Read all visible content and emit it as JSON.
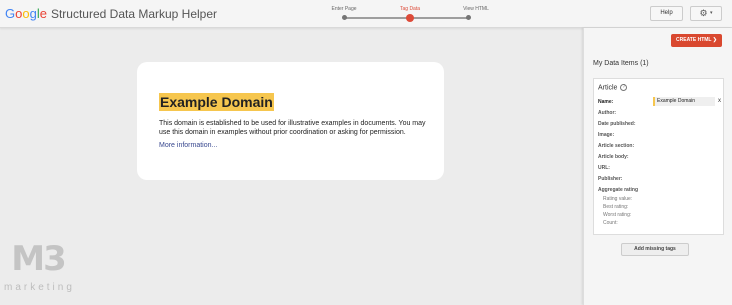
{
  "header": {
    "logo_text": "Google",
    "logo_letters": [
      {
        "char": "G",
        "color": "#4285f4"
      },
      {
        "char": "o",
        "color": "#ea4335"
      },
      {
        "char": "o",
        "color": "#fbbc05"
      },
      {
        "char": "g",
        "color": "#4285f4"
      },
      {
        "char": "l",
        "color": "#34a853"
      },
      {
        "char": "e",
        "color": "#ea4335"
      }
    ],
    "app_title": "Structured Data Markup Helper",
    "steps": [
      {
        "label": "Enter Page",
        "active": false
      },
      {
        "label": "Tag Data",
        "active": true
      },
      {
        "label": "View HTML",
        "active": false
      }
    ],
    "help_label": "Help",
    "settings_icon": "gear-icon",
    "settings_caret": "▾"
  },
  "page": {
    "heading": "Example Domain",
    "paragraph": "This domain is established to be used for illustrative examples in documents. You may use this domain in examples without prior coordination or asking for permission.",
    "link": "More information..."
  },
  "watermark": {
    "letters": "M3",
    "sub": "marketing"
  },
  "panel": {
    "create_label": "CREATE HTML ❯",
    "title": "My Data Items (1)",
    "item_type": "Article",
    "name_value": "Example Domain",
    "remove_label": "x",
    "fields": [
      "Name:",
      "Author:",
      "Date published:",
      "Image:",
      "Article section:",
      "Article body:",
      "URL:",
      "Publisher:",
      "Aggregate rating"
    ],
    "subfields": [
      "Rating value:",
      "Best rating:",
      "Worst rating:",
      "Count:"
    ],
    "missing_label": "Add missing tags"
  },
  "colors": {
    "accent": "#dd4b39",
    "highlight": "#f6c64e",
    "link": "#38488f"
  }
}
